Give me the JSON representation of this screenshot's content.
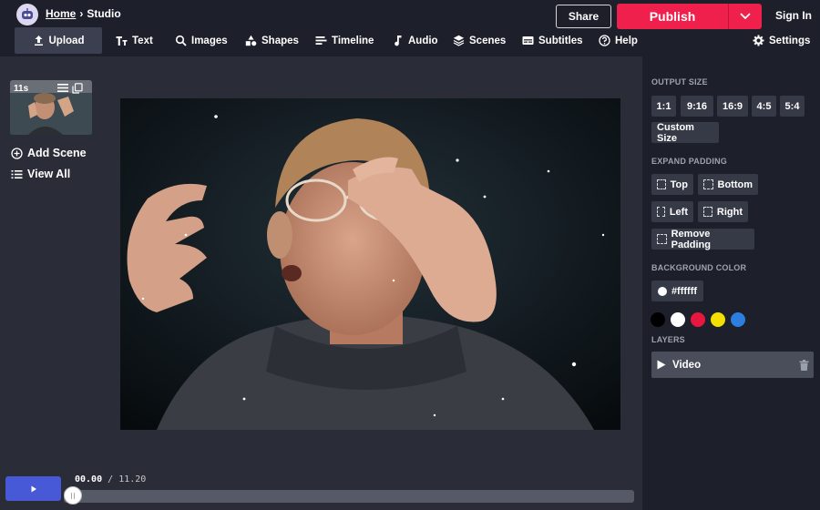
{
  "app": {
    "breadcrumb": {
      "home": "Home",
      "separator": "›",
      "current": "Studio"
    },
    "logo_icon": "robot-icon"
  },
  "header": {
    "share_label": "Share",
    "publish_label": "Publish",
    "signin_label": "Sign In",
    "accent": "#f0204d"
  },
  "toolbar": {
    "items": [
      {
        "label": "Upload",
        "icon": "upload-icon"
      },
      {
        "label": "Text",
        "icon": "text-icon"
      },
      {
        "label": "Images",
        "icon": "search-icon"
      },
      {
        "label": "Shapes",
        "icon": "shapes-icon"
      },
      {
        "label": "Timeline",
        "icon": "timeline-icon"
      },
      {
        "label": "Audio",
        "icon": "music-note-icon"
      },
      {
        "label": "Scenes",
        "icon": "layers-icon"
      },
      {
        "label": "Subtitles",
        "icon": "subtitles-icon"
      },
      {
        "label": "Help",
        "icon": "help-icon"
      }
    ],
    "settings_label": "Settings"
  },
  "scenes": {
    "thumb_duration": "11s",
    "add_label": "Add Scene",
    "view_all_label": "View All"
  },
  "playback": {
    "current": "00.00",
    "separator": "/",
    "total": "11.20",
    "progress": 0
  },
  "panel": {
    "output_size": {
      "title": "OUTPUT SIZE",
      "ratios": [
        "1:1",
        "9:16",
        "16:9",
        "4:5",
        "5:4"
      ],
      "custom_label": "Custom Size"
    },
    "expand_padding": {
      "title": "EXPAND PADDING",
      "top": "Top",
      "bottom": "Bottom",
      "left": "Left",
      "right": "Right",
      "remove": "Remove Padding"
    },
    "background": {
      "title": "BACKGROUND COLOR",
      "value": "#ffffff",
      "swatches": [
        "#000000",
        "#ffffff",
        "#e8173f",
        "#f3e000",
        "#2c7fe0"
      ]
    },
    "layers": {
      "title": "LAYERS",
      "items": [
        {
          "label": "Video"
        }
      ]
    }
  }
}
